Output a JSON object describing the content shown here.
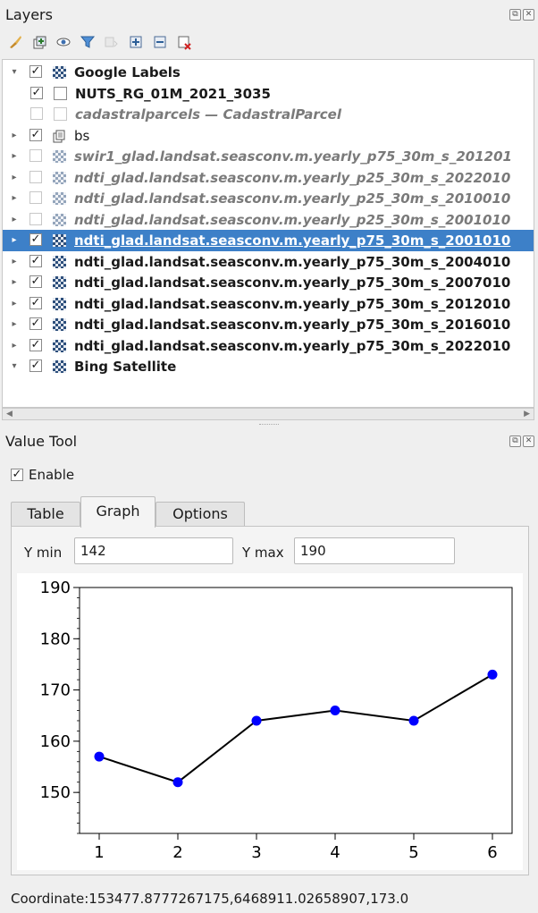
{
  "layers_panel": {
    "title": "Layers",
    "title_buttons": [
      "float",
      "close"
    ]
  },
  "toolbar": {
    "tools": [
      {
        "name": "style-brush-icon",
        "enabled": true
      },
      {
        "name": "add-group-icon",
        "enabled": true
      },
      {
        "name": "visibility-eye-icon",
        "enabled": true
      },
      {
        "name": "filter-legend-icon",
        "enabled": true
      },
      {
        "name": "filter-expression-icon",
        "enabled": false
      },
      {
        "name": "expand-all-icon",
        "enabled": true
      },
      {
        "name": "collapse-all-icon",
        "enabled": true
      },
      {
        "name": "remove-layer-icon",
        "enabled": true
      }
    ]
  },
  "layers": [
    {
      "label": "Google Labels",
      "indent": 0,
      "arrow": "down",
      "checked": true,
      "icon": "raster",
      "style": "bold"
    },
    {
      "label": "NUTS_RG_01M_2021_3035",
      "indent": 1,
      "arrow": "none",
      "checked": true,
      "icon": "vector",
      "style": "bold"
    },
    {
      "label": "cadastralparcels — CadastralParcel",
      "indent": 1,
      "arrow": "none",
      "checked": false,
      "icon": "vector",
      "style": "italic"
    },
    {
      "label": "bs",
      "indent": 0,
      "arrow": "right",
      "checked": true,
      "icon": "group",
      "style": "normal"
    },
    {
      "label": "swir1_glad.landsat.seasconv.m.yearly_p75_30m_s_201201",
      "indent": 0,
      "arrow": "right",
      "checked": false,
      "icon": "raster",
      "style": "italic"
    },
    {
      "label": "ndti_glad.landsat.seasconv.m.yearly_p25_30m_s_2022010",
      "indent": 0,
      "arrow": "right",
      "checked": false,
      "icon": "raster",
      "style": "italic"
    },
    {
      "label": "ndti_glad.landsat.seasconv.m.yearly_p25_30m_s_2010010",
      "indent": 0,
      "arrow": "right",
      "checked": false,
      "icon": "raster",
      "style": "italic"
    },
    {
      "label": "ndti_glad.landsat.seasconv.m.yearly_p25_30m_s_2001010",
      "indent": 0,
      "arrow": "right",
      "checked": false,
      "icon": "raster",
      "style": "italic"
    },
    {
      "label": "ndti_glad.landsat.seasconv.m.yearly_p75_30m_s_2001010",
      "indent": 0,
      "arrow": "right",
      "checked": true,
      "icon": "raster",
      "style": "bold",
      "selected": true
    },
    {
      "label": "ndti_glad.landsat.seasconv.m.yearly_p75_30m_s_2004010",
      "indent": 0,
      "arrow": "right",
      "checked": true,
      "icon": "raster",
      "style": "bold"
    },
    {
      "label": "ndti_glad.landsat.seasconv.m.yearly_p75_30m_s_2007010",
      "indent": 0,
      "arrow": "right",
      "checked": true,
      "icon": "raster",
      "style": "bold"
    },
    {
      "label": "ndti_glad.landsat.seasconv.m.yearly_p75_30m_s_2012010",
      "indent": 0,
      "arrow": "right",
      "checked": true,
      "icon": "raster",
      "style": "bold"
    },
    {
      "label": "ndti_glad.landsat.seasconv.m.yearly_p75_30m_s_2016010",
      "indent": 0,
      "arrow": "right",
      "checked": true,
      "icon": "raster",
      "style": "bold"
    },
    {
      "label": "ndti_glad.landsat.seasconv.m.yearly_p75_30m_s_2022010",
      "indent": 0,
      "arrow": "right",
      "checked": true,
      "icon": "raster",
      "style": "bold"
    },
    {
      "label": "Bing Satellite",
      "indent": 0,
      "arrow": "down",
      "checked": true,
      "icon": "raster",
      "style": "bold"
    }
  ],
  "value_tool": {
    "title": "Value Tool",
    "enable_label": "Enable",
    "enable_checked": true,
    "tabs": [
      "Table",
      "Graph",
      "Options"
    ],
    "active_tab": "Graph",
    "ymin_label": "Y min",
    "ymin_value": "142",
    "ymax_label": "Y max",
    "ymax_value": "190",
    "coordinate": "Coordinate:153477.8777267175,6468911.02658907,173.0"
  },
  "chart_data": {
    "type": "line",
    "x": [
      1,
      2,
      3,
      4,
      5,
      6
    ],
    "values": [
      157,
      152,
      164,
      166,
      164,
      173
    ],
    "xlim": [
      0.75,
      6.25
    ],
    "ylim": [
      142,
      190
    ],
    "yticks": [
      150,
      160,
      170,
      180,
      190
    ],
    "xticks": [
      1,
      2,
      3,
      4,
      5,
      6
    ],
    "line_color": "#000000",
    "marker_color": "#0000ff",
    "grid": false
  },
  "colors": {
    "selected_row": "#3d80c8",
    "panel_bg": "#efefef"
  }
}
